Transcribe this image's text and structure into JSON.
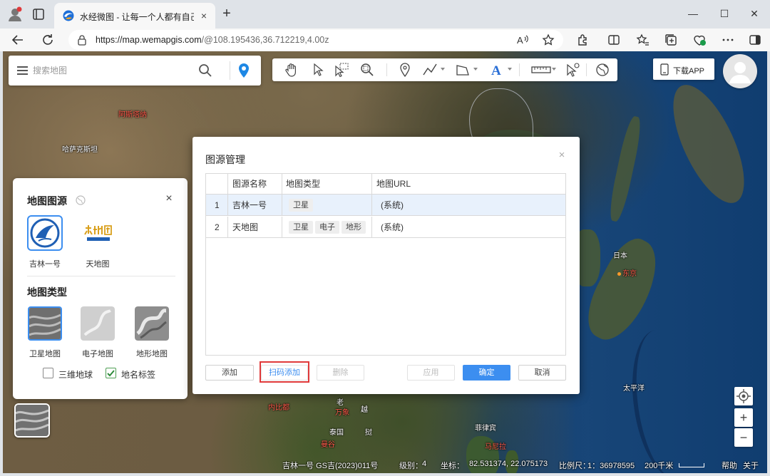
{
  "browser": {
    "tab_title": "水经微图 - 让每一个人都有自己的",
    "tab_close": "×",
    "new_tab": "+",
    "url_host": "https://map.wemapgis.com",
    "url_path": "/@108.195436,36.712219,4.00z",
    "window_controls": {
      "minimize": "—",
      "maximize": "☐",
      "close": "✕"
    }
  },
  "search": {
    "placeholder": "搜索地图"
  },
  "download_app": {
    "label": "下载APP"
  },
  "map_labels": {
    "north_korea": "阿斯塔纳",
    "kazakhstan": "哈萨克斯坦",
    "japan": "日本",
    "tokyo": "东京",
    "pacific": "太平洋",
    "naypyidaw": "内比都",
    "laos": "老",
    "vientiane": "万象",
    "vietnam_a": "越",
    "vietnam_b": "挝",
    "thailand": "泰国",
    "bangkok": "曼谷",
    "philippines": "菲律宾",
    "manila": "马尼拉"
  },
  "source_panel": {
    "title": "地图图源",
    "close": "×",
    "sources": [
      {
        "label": "吉林一号",
        "icon": "jilin-logo-icon",
        "selected": true
      },
      {
        "label": "天地图",
        "icon": "tianditu-logo-icon",
        "selected": false
      }
    ],
    "type_title": "地图类型",
    "types": [
      {
        "label": "卫星地图",
        "selected": true
      },
      {
        "label": "电子地图",
        "selected": false
      },
      {
        "label": "地形地图",
        "selected": false
      }
    ],
    "checkboxes": [
      {
        "label": "三维地球",
        "checked": false
      },
      {
        "label": "地名标签",
        "checked": true
      }
    ]
  },
  "dialog": {
    "title": "图源管理",
    "close": "×",
    "columns": [
      "图源名称",
      "地图类型",
      "地图URL"
    ],
    "rows": [
      {
        "index": "1",
        "name": "吉林一号",
        "types": [
          "卫星"
        ],
        "url": "(系统)",
        "selected": true
      },
      {
        "index": "2",
        "name": "天地图",
        "types": [
          "卫星",
          "电子",
          "地形"
        ],
        "url": "(系统)",
        "selected": false
      }
    ],
    "buttons": {
      "add": "添加",
      "scan_add": "扫码添加",
      "delete": "删除",
      "apply": "应用",
      "ok": "确定",
      "cancel": "取消"
    }
  },
  "map_controls": {
    "zoom_in": "+",
    "zoom_out": "−"
  },
  "status_bar": {
    "attribution": "吉林一号 GS吉(2023)011号",
    "level_label": "级别：",
    "level_value": "4",
    "coord_label": "坐标：",
    "coord_value": "82.531374, 22.075173",
    "scale_label": "比例尺：",
    "scale_value": "1：36978595",
    "scale_bar": "200千米",
    "help": "帮助",
    "about": "关于"
  },
  "colors": {
    "accent": "#3c8ef0",
    "highlight_box": "#e0393a",
    "location_pin": "#1e88e5"
  }
}
